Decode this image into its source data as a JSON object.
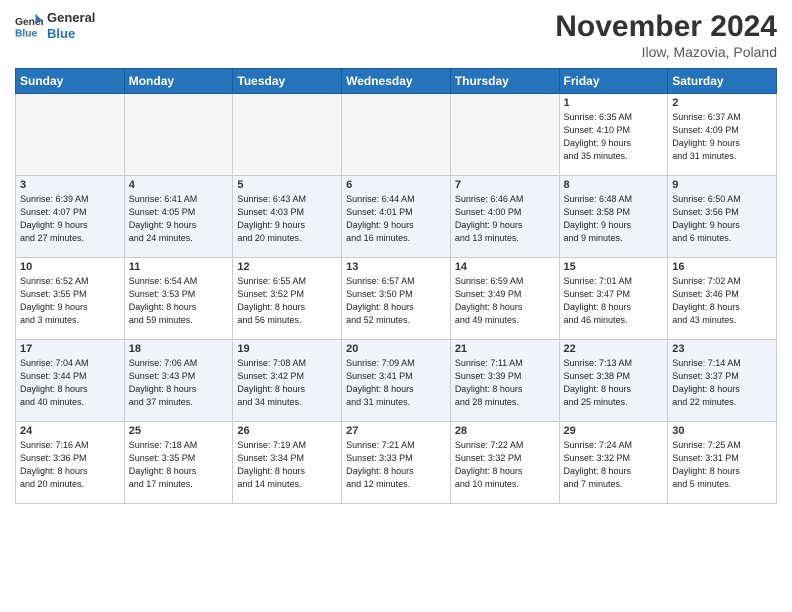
{
  "header": {
    "logo_line1": "General",
    "logo_line2": "Blue",
    "month": "November 2024",
    "location": "Ilow, Mazovia, Poland"
  },
  "weekdays": [
    "Sunday",
    "Monday",
    "Tuesday",
    "Wednesday",
    "Thursday",
    "Friday",
    "Saturday"
  ],
  "weeks": [
    [
      {
        "day": "",
        "info": ""
      },
      {
        "day": "",
        "info": ""
      },
      {
        "day": "",
        "info": ""
      },
      {
        "day": "",
        "info": ""
      },
      {
        "day": "",
        "info": ""
      },
      {
        "day": "1",
        "info": "Sunrise: 6:35 AM\nSunset: 4:10 PM\nDaylight: 9 hours\nand 35 minutes."
      },
      {
        "day": "2",
        "info": "Sunrise: 6:37 AM\nSunset: 4:09 PM\nDaylight: 9 hours\nand 31 minutes."
      }
    ],
    [
      {
        "day": "3",
        "info": "Sunrise: 6:39 AM\nSunset: 4:07 PM\nDaylight: 9 hours\nand 27 minutes."
      },
      {
        "day": "4",
        "info": "Sunrise: 6:41 AM\nSunset: 4:05 PM\nDaylight: 9 hours\nand 24 minutes."
      },
      {
        "day": "5",
        "info": "Sunrise: 6:43 AM\nSunset: 4:03 PM\nDaylight: 9 hours\nand 20 minutes."
      },
      {
        "day": "6",
        "info": "Sunrise: 6:44 AM\nSunset: 4:01 PM\nDaylight: 9 hours\nand 16 minutes."
      },
      {
        "day": "7",
        "info": "Sunrise: 6:46 AM\nSunset: 4:00 PM\nDaylight: 9 hours\nand 13 minutes."
      },
      {
        "day": "8",
        "info": "Sunrise: 6:48 AM\nSunset: 3:58 PM\nDaylight: 9 hours\nand 9 minutes."
      },
      {
        "day": "9",
        "info": "Sunrise: 6:50 AM\nSunset: 3:56 PM\nDaylight: 9 hours\nand 6 minutes."
      }
    ],
    [
      {
        "day": "10",
        "info": "Sunrise: 6:52 AM\nSunset: 3:55 PM\nDaylight: 9 hours\nand 3 minutes."
      },
      {
        "day": "11",
        "info": "Sunrise: 6:54 AM\nSunset: 3:53 PM\nDaylight: 8 hours\nand 59 minutes."
      },
      {
        "day": "12",
        "info": "Sunrise: 6:55 AM\nSunset: 3:52 PM\nDaylight: 8 hours\nand 56 minutes."
      },
      {
        "day": "13",
        "info": "Sunrise: 6:57 AM\nSunset: 3:50 PM\nDaylight: 8 hours\nand 52 minutes."
      },
      {
        "day": "14",
        "info": "Sunrise: 6:59 AM\nSunset: 3:49 PM\nDaylight: 8 hours\nand 49 minutes."
      },
      {
        "day": "15",
        "info": "Sunrise: 7:01 AM\nSunset: 3:47 PM\nDaylight: 8 hours\nand 46 minutes."
      },
      {
        "day": "16",
        "info": "Sunrise: 7:02 AM\nSunset: 3:46 PM\nDaylight: 8 hours\nand 43 minutes."
      }
    ],
    [
      {
        "day": "17",
        "info": "Sunrise: 7:04 AM\nSunset: 3:44 PM\nDaylight: 8 hours\nand 40 minutes."
      },
      {
        "day": "18",
        "info": "Sunrise: 7:06 AM\nSunset: 3:43 PM\nDaylight: 8 hours\nand 37 minutes."
      },
      {
        "day": "19",
        "info": "Sunrise: 7:08 AM\nSunset: 3:42 PM\nDaylight: 8 hours\nand 34 minutes."
      },
      {
        "day": "20",
        "info": "Sunrise: 7:09 AM\nSunset: 3:41 PM\nDaylight: 8 hours\nand 31 minutes."
      },
      {
        "day": "21",
        "info": "Sunrise: 7:11 AM\nSunset: 3:39 PM\nDaylight: 8 hours\nand 28 minutes."
      },
      {
        "day": "22",
        "info": "Sunrise: 7:13 AM\nSunset: 3:38 PM\nDaylight: 8 hours\nand 25 minutes."
      },
      {
        "day": "23",
        "info": "Sunrise: 7:14 AM\nSunset: 3:37 PM\nDaylight: 8 hours\nand 22 minutes."
      }
    ],
    [
      {
        "day": "24",
        "info": "Sunrise: 7:16 AM\nSunset: 3:36 PM\nDaylight: 8 hours\nand 20 minutes."
      },
      {
        "day": "25",
        "info": "Sunrise: 7:18 AM\nSunset: 3:35 PM\nDaylight: 8 hours\nand 17 minutes."
      },
      {
        "day": "26",
        "info": "Sunrise: 7:19 AM\nSunset: 3:34 PM\nDaylight: 8 hours\nand 14 minutes."
      },
      {
        "day": "27",
        "info": "Sunrise: 7:21 AM\nSunset: 3:33 PM\nDaylight: 8 hours\nand 12 minutes."
      },
      {
        "day": "28",
        "info": "Sunrise: 7:22 AM\nSunset: 3:32 PM\nDaylight: 8 hours\nand 10 minutes."
      },
      {
        "day": "29",
        "info": "Sunrise: 7:24 AM\nSunset: 3:32 PM\nDaylight: 8 hours\nand 7 minutes."
      },
      {
        "day": "30",
        "info": "Sunrise: 7:25 AM\nSunset: 3:31 PM\nDaylight: 8 hours\nand 5 minutes."
      }
    ]
  ]
}
